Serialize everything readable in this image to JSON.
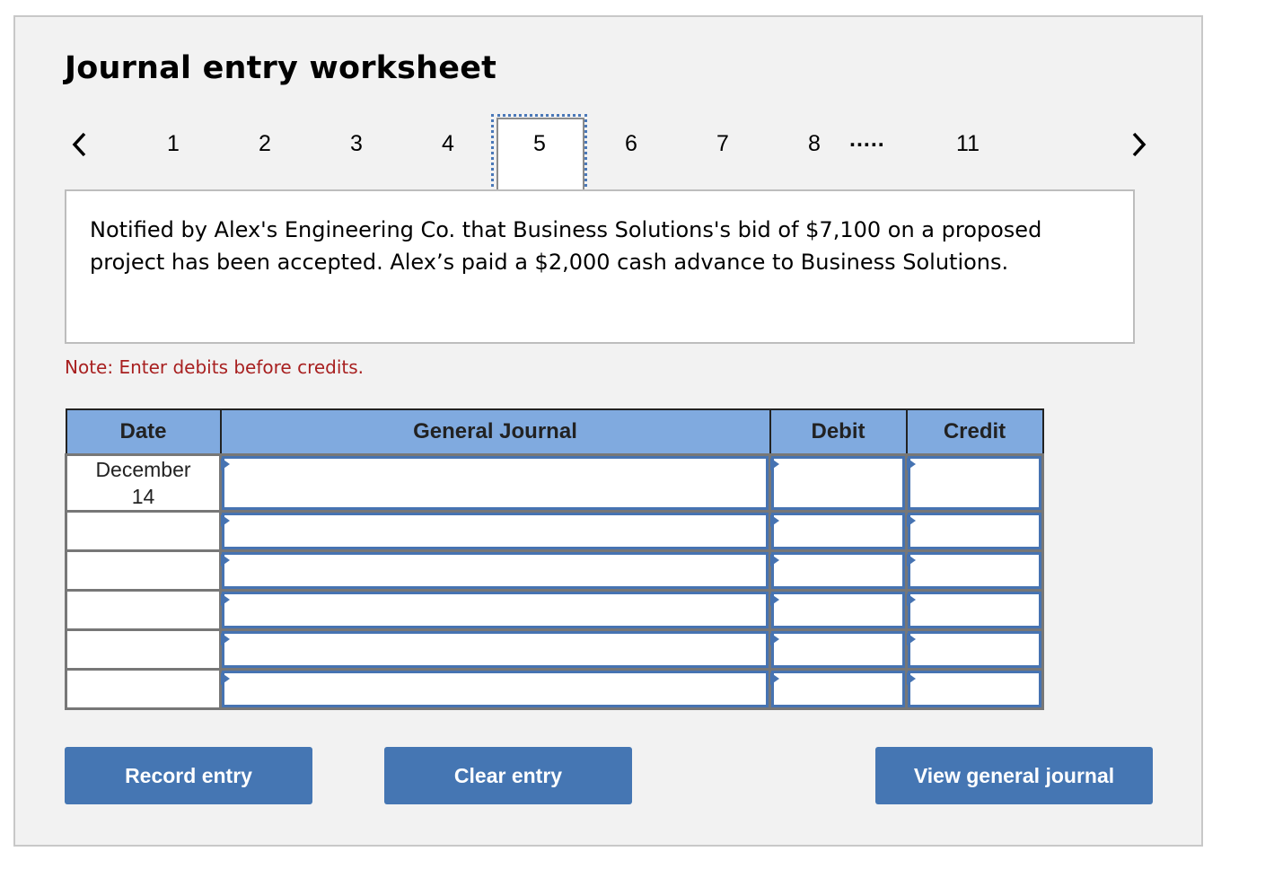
{
  "header": {
    "title": "Journal entry worksheet"
  },
  "pagination": {
    "prev_icon": "chevron-left-icon",
    "next_icon": "chevron-right-icon",
    "pages": [
      "1",
      "2",
      "3",
      "4",
      "5",
      "6",
      "7",
      "8"
    ],
    "ellipsis": ".....",
    "last_page": "11",
    "current_page": "5"
  },
  "transaction": {
    "description": "Notified by Alex's Engineering Co. that Business Solutions's bid of $7,100 on a proposed project has been accepted. Alex’s paid a $2,000 cash advance to Business Solutions."
  },
  "note": "Note: Enter debits before credits.",
  "journal": {
    "columns": [
      "Date",
      "General Journal",
      "Debit",
      "Credit"
    ],
    "rows": [
      {
        "date": "December\n14",
        "account": "",
        "debit": "",
        "credit": ""
      },
      {
        "date": "",
        "account": "",
        "debit": "",
        "credit": ""
      },
      {
        "date": "",
        "account": "",
        "debit": "",
        "credit": ""
      },
      {
        "date": "",
        "account": "",
        "debit": "",
        "credit": ""
      },
      {
        "date": "",
        "account": "",
        "debit": "",
        "credit": ""
      },
      {
        "date": "",
        "account": "",
        "debit": "",
        "credit": ""
      }
    ]
  },
  "buttons": {
    "record": "Record entry",
    "clear": "Clear entry",
    "view": "View general journal"
  },
  "colors": {
    "accent": "#4576b3",
    "header_bg": "#80aadf",
    "note": "#a82020",
    "panel_bg": "#f2f2f2"
  }
}
